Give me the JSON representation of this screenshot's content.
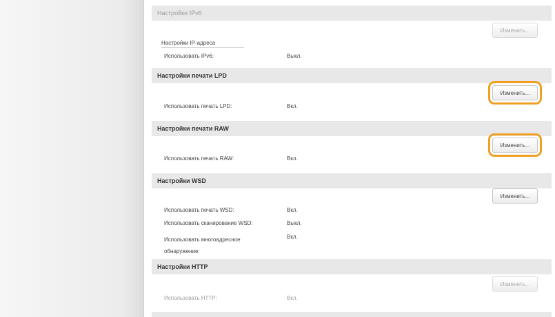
{
  "sections": {
    "ipv6": {
      "title": "Настройки IPv6",
      "change_label": "Изменить...",
      "subsection_title": "Настройки IP-адреса",
      "use_label": "Использовать IPv6:",
      "use_value": "Выкл."
    },
    "lpd": {
      "title": "Настройки печати LPD",
      "change_label": "Изменить...",
      "use_label": "Использовать печать LPD:",
      "use_value": "Вкл."
    },
    "raw": {
      "title": "Настройки печати RAW",
      "change_label": "Изменить...",
      "use_label": "Использовать печать RAW:",
      "use_value": "Вкл."
    },
    "wsd": {
      "title": "Настройки WSD",
      "change_label": "Изменить...",
      "rows": [
        {
          "label": "Использовать печать WSD:",
          "value": "Вкл."
        },
        {
          "label": "Использовать сканирование WSD:",
          "value": "Выкл."
        },
        {
          "label": "Использовать многоадресное обнаружение:",
          "value": "Вкл."
        }
      ]
    },
    "http": {
      "title": "Настройки HTTP",
      "change_label": "Изменить...",
      "use_label": "Использовать HTTP:",
      "use_value": "Вкл."
    }
  },
  "colors": {
    "highlight": "#f0a020",
    "header_bg": "#e8e8e8",
    "sidebar_bg": "#ececec"
  }
}
